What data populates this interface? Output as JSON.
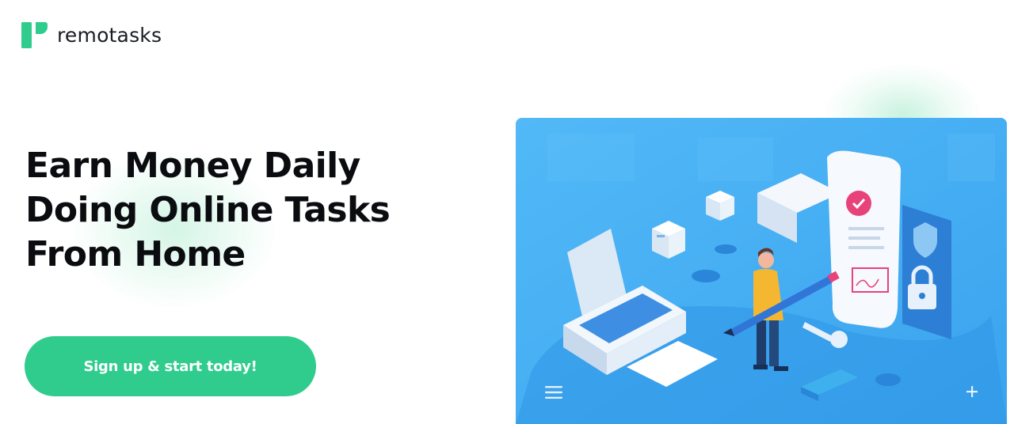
{
  "brand": {
    "name": "remotasks",
    "color": "#2fcc8d",
    "logo_icon": "remotasks-logo-icon"
  },
  "hero": {
    "headline": [
      "Earn Money Daily",
      "Doing Online Tasks",
      "From Home"
    ],
    "cta_label": "Sign up & start today!",
    "illustration_colors": {
      "background": "#4ab2f5",
      "accent_pink": "#e8427a",
      "accent_yellow": "#f5b731"
    },
    "controls": {
      "menu_icon": "hamburger-menu-icon",
      "plus_icon": "plus-icon"
    }
  }
}
